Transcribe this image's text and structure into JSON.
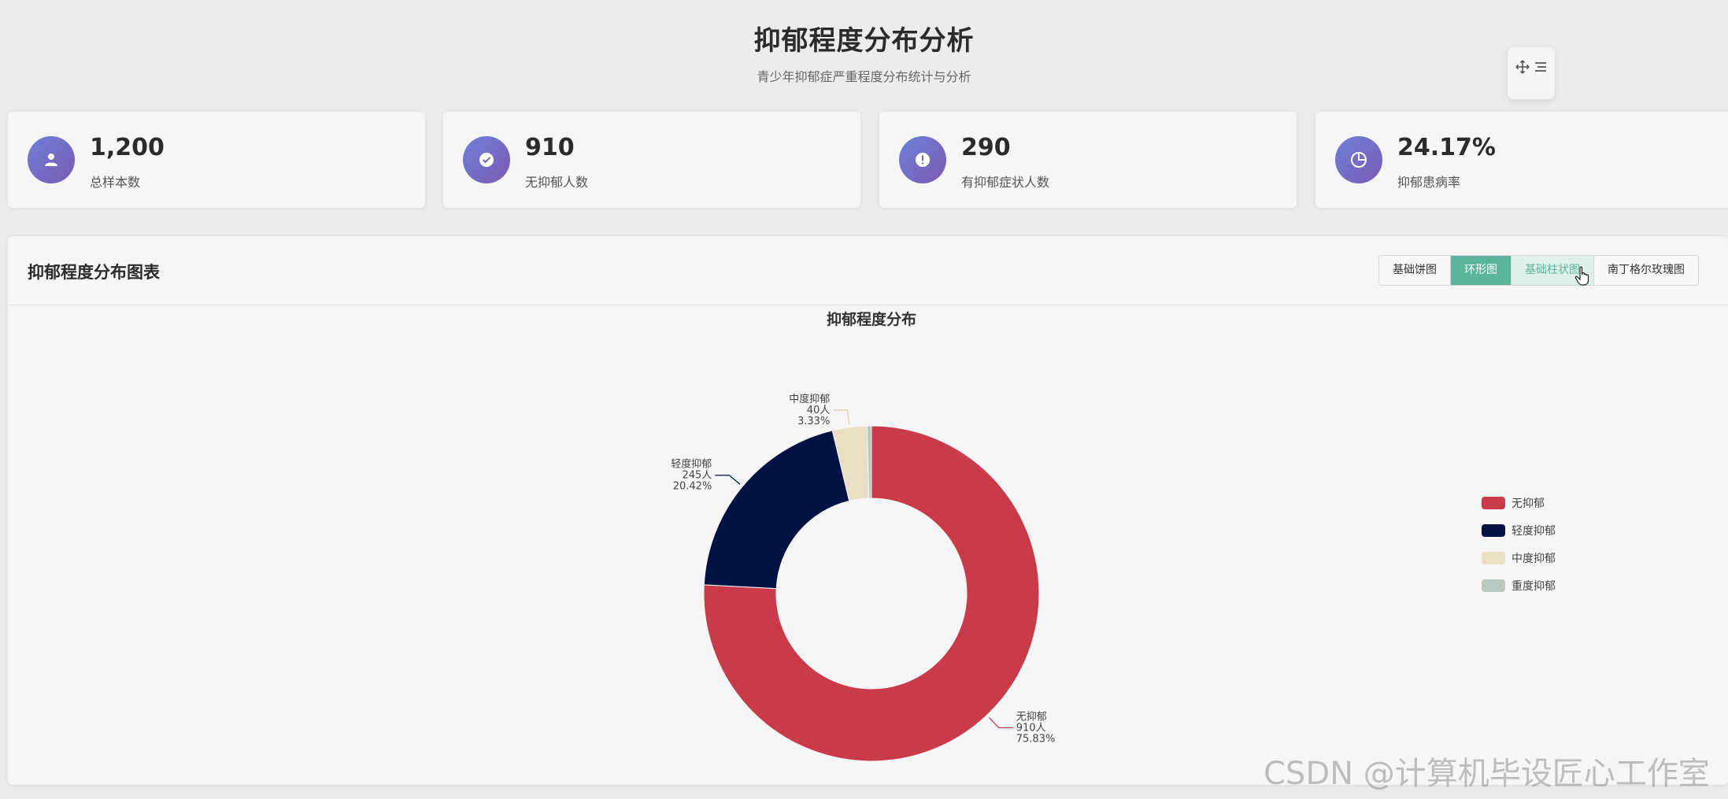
{
  "header": {
    "title": "抑郁程度分布分析",
    "subtitle": "青少年抑郁症严重程度分布统计与分析"
  },
  "float_tools": {
    "move_icon": "move-icon",
    "menu_icon": "menu-icon"
  },
  "stats": [
    {
      "value": "1,200",
      "label": "总样本数",
      "icon": "user-icon"
    },
    {
      "value": "910",
      "label": "无抑郁人数",
      "icon": "check-circle-icon"
    },
    {
      "value": "290",
      "label": "有抑郁症状人数",
      "icon": "alert-icon"
    },
    {
      "value": "24.17%",
      "label": "抑郁患病率",
      "icon": "pie-chart-icon"
    }
  ],
  "panel": {
    "title": "抑郁程度分布图表",
    "buttons": [
      {
        "label": "基础饼图",
        "state": "normal"
      },
      {
        "label": "环形图",
        "state": "active"
      },
      {
        "label": "基础柱状图",
        "state": "hover"
      },
      {
        "label": "南丁格尔玫瑰图",
        "state": "normal"
      }
    ]
  },
  "colors": {
    "accent": "#5bb59d",
    "icon_gradient_start": "#6e7fd8",
    "icon_gradient_end": "#7a5bb2"
  },
  "watermark": "CSDN @计算机毕设匠心工作室",
  "chart_data": {
    "type": "pie",
    "variant": "donut",
    "title": "抑郁程度分布",
    "legend_position": "right",
    "categories": [
      "无抑郁",
      "轻度抑郁",
      "中度抑郁",
      "重度抑郁"
    ],
    "values": [
      910,
      245,
      40,
      5
    ],
    "colors": [
      "#c93a4b",
      "#001244",
      "#e8dfc4",
      "#b7cabd"
    ],
    "labels": [
      {
        "name": "无抑郁",
        "count": "910人",
        "pct": "75.83%"
      },
      {
        "name": "轻度抑郁",
        "count": "245人",
        "pct": "20.42%"
      },
      {
        "name": "中度抑郁",
        "count": "40人",
        "pct": "3.33%"
      }
    ]
  }
}
